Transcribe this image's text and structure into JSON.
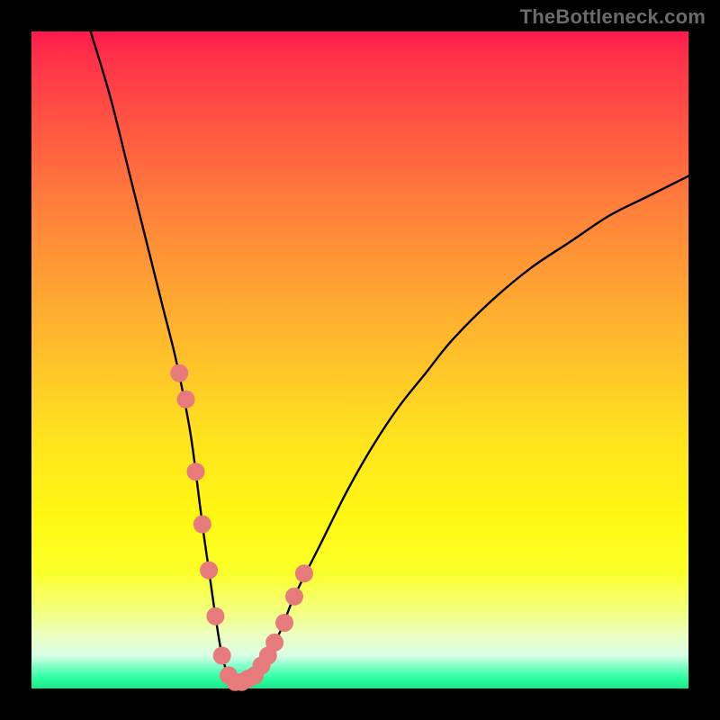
{
  "watermark": "TheBottleneck.com",
  "chart_data": {
    "type": "line",
    "title": "",
    "xlabel": "",
    "ylabel": "",
    "xlim": [
      0,
      100
    ],
    "ylim": [
      0,
      100
    ],
    "grid": false,
    "legend": false,
    "background_gradient": {
      "top_color": "#ff1a4d",
      "middle_color": "#ffe31e",
      "bottom_color": "#18e88a"
    },
    "series": [
      {
        "name": "bottleneck-curve",
        "color": "#000000",
        "x": [
          9,
          12,
          15,
          18,
          20,
          22,
          24,
          25,
          26,
          27,
          28,
          29,
          30,
          31,
          32,
          34,
          36,
          38,
          40,
          44,
          48,
          52,
          56,
          60,
          64,
          70,
          76,
          82,
          88,
          94,
          100
        ],
        "y": [
          100,
          90,
          78,
          66,
          58,
          50,
          40,
          33,
          25,
          18,
          11,
          5,
          2,
          1,
          1,
          2,
          5,
          9,
          14,
          22,
          30,
          37,
          43,
          48,
          53,
          59,
          64,
          68,
          72,
          75,
          78
        ]
      }
    ],
    "highlight_points": {
      "color": "#e77a7a",
      "radius_px": 10,
      "left_branch_x": [
        22.5,
        23.5,
        25.0,
        26.0,
        27.0,
        28.0,
        29.0,
        30.0
      ],
      "left_branch_y": [
        48,
        44,
        33,
        25,
        18,
        11,
        5,
        2
      ],
      "right_branch_x": [
        31.0,
        32.0,
        33.0,
        34.0,
        35.0,
        36.0,
        37.0,
        38.5,
        40.0,
        41.5
      ],
      "right_branch_y": [
        1,
        1,
        1.5,
        2,
        3.5,
        5,
        7,
        10,
        14,
        17.5
      ]
    }
  }
}
